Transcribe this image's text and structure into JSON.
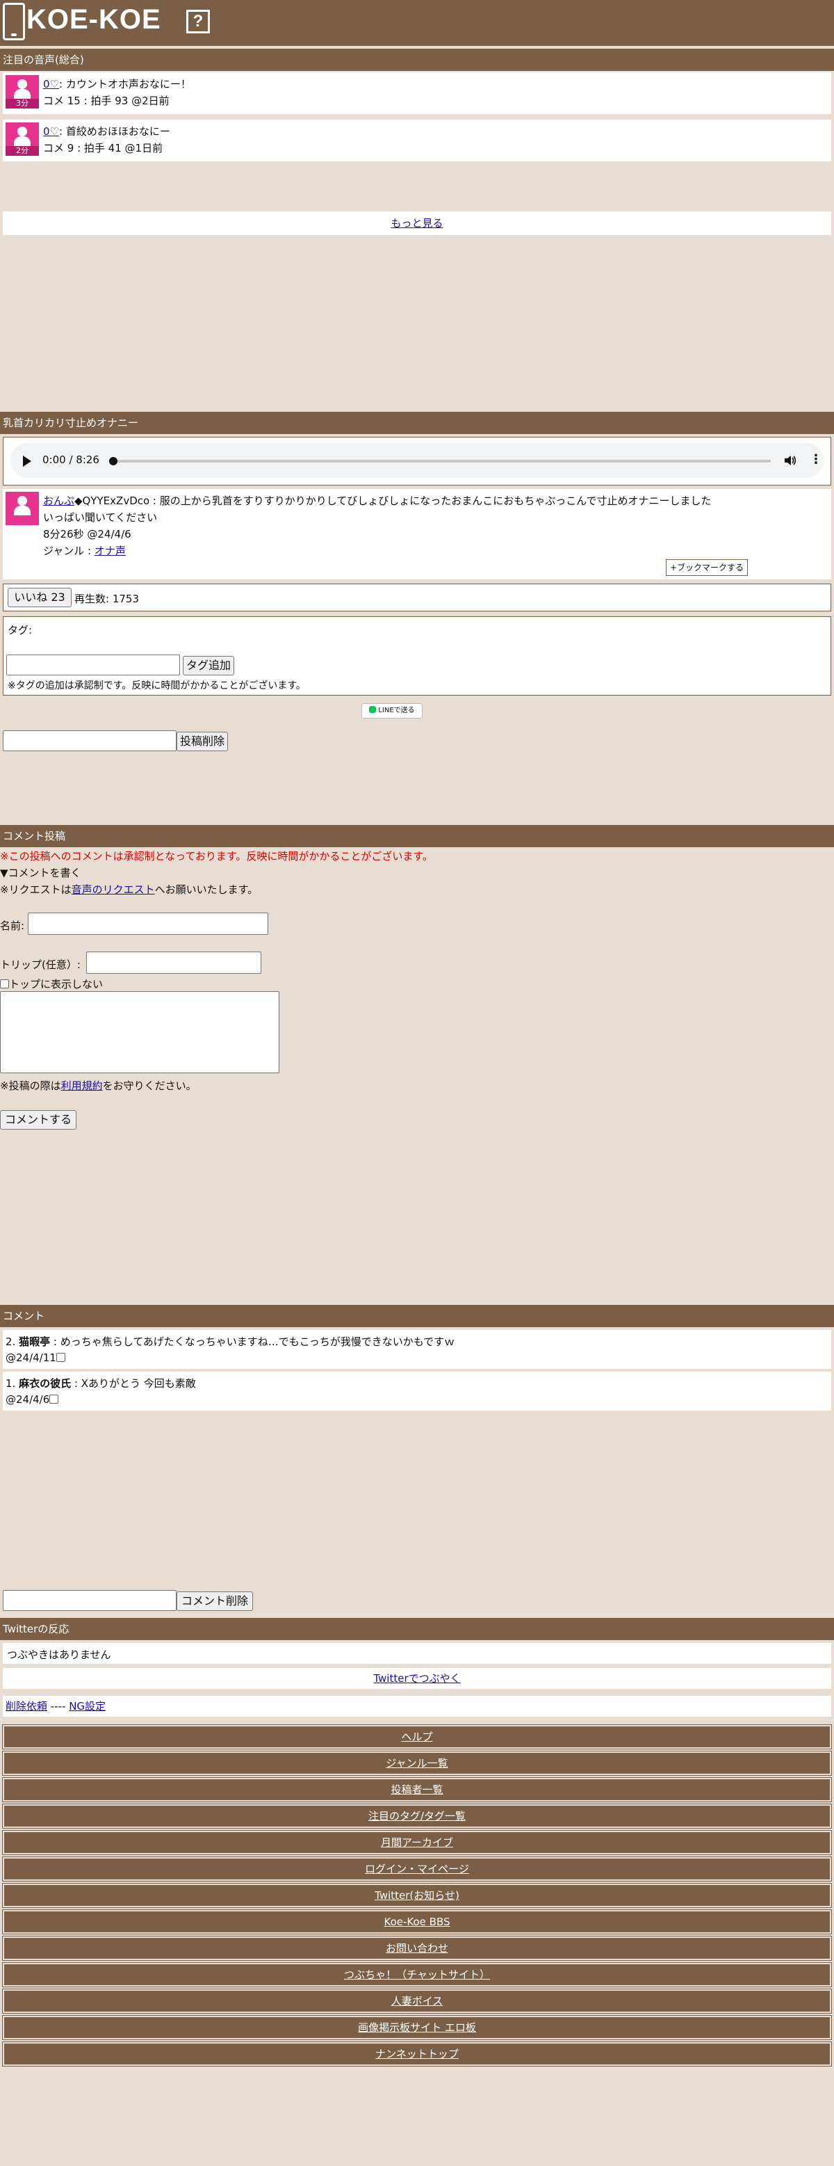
{
  "header": {
    "logo": "KOE-KOE",
    "help": "?"
  },
  "featured": {
    "title": "注目の音声(総合)",
    "items": [
      {
        "duration": "3分",
        "heart": "0♡",
        "line1": ": カウントオホ声おなにー！",
        "line2": "コメ 15 : 拍手 93 @2日前"
      },
      {
        "duration": "2分",
        "heart": "0♡",
        "line1": ": 首絞めおほほおなにー",
        "line2": "コメ 9 : 拍手 41 @1日前"
      }
    ],
    "more": "もっと見る"
  },
  "post": {
    "title": "乳首カリカリ寸止めオナニー",
    "audio_time": "0:00 / 8:26",
    "author": "おんぷ",
    "trip": "◆QYYExZvDco : 服の上から乳首をすりすりかりかりしてびしょびしょになったおまんこにおもちゃぶっこんで寸止めオナニーしました",
    "desc": "いっぱい聞いてください",
    "meta": "8分26秒 @24/4/6",
    "genre_label": "ジャンル : ",
    "genre": "オナ声",
    "bookmark": "+ブックマークする",
    "like": "いいね 23",
    "plays": "再生数: 1753"
  },
  "tags": {
    "label": "タグ:",
    "add_button": "タグ追加",
    "note": "※タグの追加は承認制です。反映に時間がかかることがございます。"
  },
  "line_share": "LINEで送る",
  "delete_post": "投稿削除",
  "comment_form": {
    "title": "コメント投稿",
    "warning": "※この投稿へのコメントは承認制となっております。反映に時間がかかることがございます。",
    "toggle": "▼コメントを書く",
    "request_pre": "※リクエストは",
    "request_link": "音声のリクエスト",
    "request_post": "へお願いいたします。",
    "name_label": "名前:",
    "trip_label": "トリップ(任意）:",
    "hide_top": "トップに表示しない",
    "rules_pre": "※投稿の際は",
    "rules_link": "利用規約",
    "rules_post": "をお守りください。",
    "submit": "コメントする"
  },
  "comments": {
    "title": "コメント",
    "items": [
      {
        "num": "2.",
        "name": "猫暇亭",
        "text": " : めっちゃ焦らしてあげたくなっちゃいますね…でもこっちが我慢できないかもですｗ",
        "date": "@24/4/11"
      },
      {
        "num": "1.",
        "name": "麻衣の彼氏",
        "text": " : Xありがとう 今回も素敵",
        "date": "@24/4/6"
      }
    ],
    "delete_button": "コメント削除"
  },
  "twitter": {
    "title": "Twitterの反応",
    "empty": "つぶやきはありません",
    "tweet_link": "Twitterでつぶやく",
    "delete_request": "削除依頼",
    "sep": " ---- ",
    "ng": "NG設定"
  },
  "nav": [
    "ヘルプ",
    "ジャンル一覧",
    "投稿者一覧",
    "注目のタグ/タグ一覧",
    "月間アーカイブ",
    "ログイン・マイページ",
    "Twitter(お知らせ)",
    "Koe-Koe BBS",
    "お問い合わせ",
    "つぶちゃ！（チャットサイト）",
    "人妻ボイス",
    "画像掲示板サイト エロ板",
    "ナンネットトップ"
  ],
  "colors": {
    "brand": "#7a5f46",
    "background": "#e7ddd3",
    "thumb": "#e6338d",
    "warning": "#dd0000"
  }
}
